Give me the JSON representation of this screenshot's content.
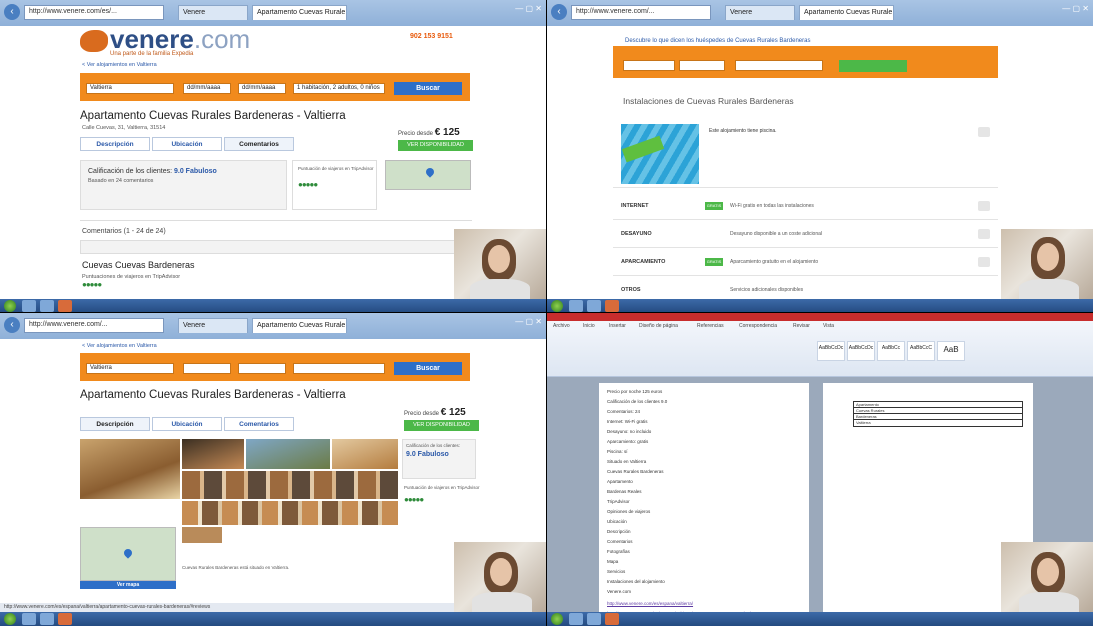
{
  "q1": {
    "tabs": [
      "http://www.venere.com/es/...",
      "Apartamento Cuevas Rurale..."
    ],
    "logo": {
      "name": "venere",
      "tld": ".com"
    },
    "tagline": "Una parte de la familia Expedia",
    "phone": "902 153 9151",
    "back_link": "< Ver alojamientos en Valtierra",
    "search": {
      "destination": "Valtierra",
      "checkin": "dd/mm/aaaa",
      "checkout": "dd/mm/aaaa",
      "rooms": "1 habitación, 2 adultos, 0 niños",
      "button": "Buscar"
    },
    "title": "Apartamento Cuevas Rurales Bardeneras - Valtierra",
    "address": "Calle Cuevas, 31, Valtierra, 31514",
    "tabs_page": [
      "Descripción",
      "Ubicación",
      "Comentarios"
    ],
    "price": {
      "label": "Precio desde",
      "value": "€ 125",
      "button": "VER DISPONIBILIDAD"
    },
    "rating": {
      "label": "Calificación de los clientes:",
      "value": "9.0 Fabuloso",
      "note": "Basado en 24 comentarios"
    },
    "ta_label": "Puntuación de viajeros en TripAdvisor",
    "section": "Comentarios (1 - 24 de 24)",
    "review_title": "Cuevas Cuevas Bardeneras",
    "review_sub": "Puntuaciones de viajeros en TripAdvisor",
    "status": "http://www.venere.com/es/espana/valtierra/apartamento-cuevas-rurales-bardeneras/#reviews"
  },
  "q2": {
    "tabs": [
      "http://www.venere.com/...",
      "Apartamento Cuevas Rurale..."
    ],
    "header_text": "Descubre lo que dicen los huéspedes de Cuevas Rurales Bardeneras",
    "section_title": "Instalaciones de Cuevas Rurales Bardeneras",
    "pool_text": "Este alojamiento tiene piscina.",
    "services": [
      {
        "name": "INTERNET",
        "badge": "GRATIS",
        "text": "Wi-Fi gratis en todas las instalaciones"
      },
      {
        "name": "DESAYUNO",
        "badge": "",
        "text": "Desayuno disponible a un coste adicional"
      },
      {
        "name": "APARCAMIENTO",
        "badge": "GRATIS",
        "text": "Aparcamiento gratuito en el alojamiento"
      },
      {
        "name": "OTROS",
        "badge": "",
        "text": "Servicios adicionales disponibles"
      }
    ]
  },
  "q3": {
    "tabs": [
      "http://www.venere.com/...",
      "Apartamento Cuevas Rurale..."
    ],
    "back_link": "< Ver alojamientos en Valtierra",
    "search": {
      "destination": "Valtierra",
      "button": "Buscar"
    },
    "title": "Apartamento Cuevas Rurales Bardeneras - Valtierra",
    "tabs_page": [
      "Descripción",
      "Ubicación",
      "Comentarios"
    ],
    "price": {
      "label": "Precio desde",
      "value": "€ 125",
      "button": "VER DISPONIBILIDAD"
    },
    "rating": {
      "label": "Calificación de los clientes:",
      "value": "9.0 Fabuloso"
    },
    "ta_label": "Puntuación de viajeros en TripAdvisor",
    "desc": "Cuevas Rurales Bardeneras está situado en Valtierra.",
    "map_button": "Ver mapa"
  },
  "q4": {
    "ribbon_tabs": [
      "Archivo",
      "Inicio",
      "Insertar",
      "Diseño de página",
      "Referencias",
      "Correspondencia",
      "Revisar",
      "Vista"
    ],
    "styles": [
      "AaBbCcDc",
      "AaBbCcDc",
      "AaBbCc",
      "AaBbCcC",
      "AaB"
    ],
    "lines": [
      "Precio por noche 125 euros",
      "Calificación de los clientes 9.0",
      "Comentarios: 24",
      "Internet: Wi-Fi gratis",
      "Desayuno: no incluido",
      "Aparcamiento: gratis",
      "Piscina: sí",
      "Situado en Valtierra",
      "Cuevas Rurales Bardeneras",
      "Apartamento",
      "Bardenas Reales",
      "TripAdvisor",
      "Opiniones de viajeros",
      "Ubicación",
      "Descripción",
      "Comentarios",
      "Fotografías",
      "Mapa",
      "Servicios",
      "Instalaciones del alojamiento",
      "Venere.com"
    ],
    "links": [
      "http://www.venere.com/es/espana/valtierra/",
      "http://www.venere.com/es/espana/valtierra/apartamento-cuevas-rurales/"
    ],
    "table_rows": [
      "Apartamento",
      "Cuevas Rurales",
      "Bardeneras",
      "Valtierra"
    ]
  }
}
